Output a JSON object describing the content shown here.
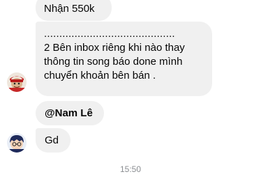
{
  "messages": [
    {
      "lines": [
        "Nhận 550k"
      ]
    },
    {
      "lines": [
        "...........................................",
        "2 Bên inbox riêng khi nào thay",
        "thông tin song báo done mình",
        "chuyển khoản bên bán ."
      ]
    },
    {
      "lines": [
        "@Nam Lê"
      ]
    },
    {
      "lines": [
        "Gd"
      ]
    }
  ],
  "timestamp": "15:50",
  "colors": {
    "bubble": "#f0f0f0",
    "text": "#050505",
    "timestamp": "#8a8d91"
  }
}
